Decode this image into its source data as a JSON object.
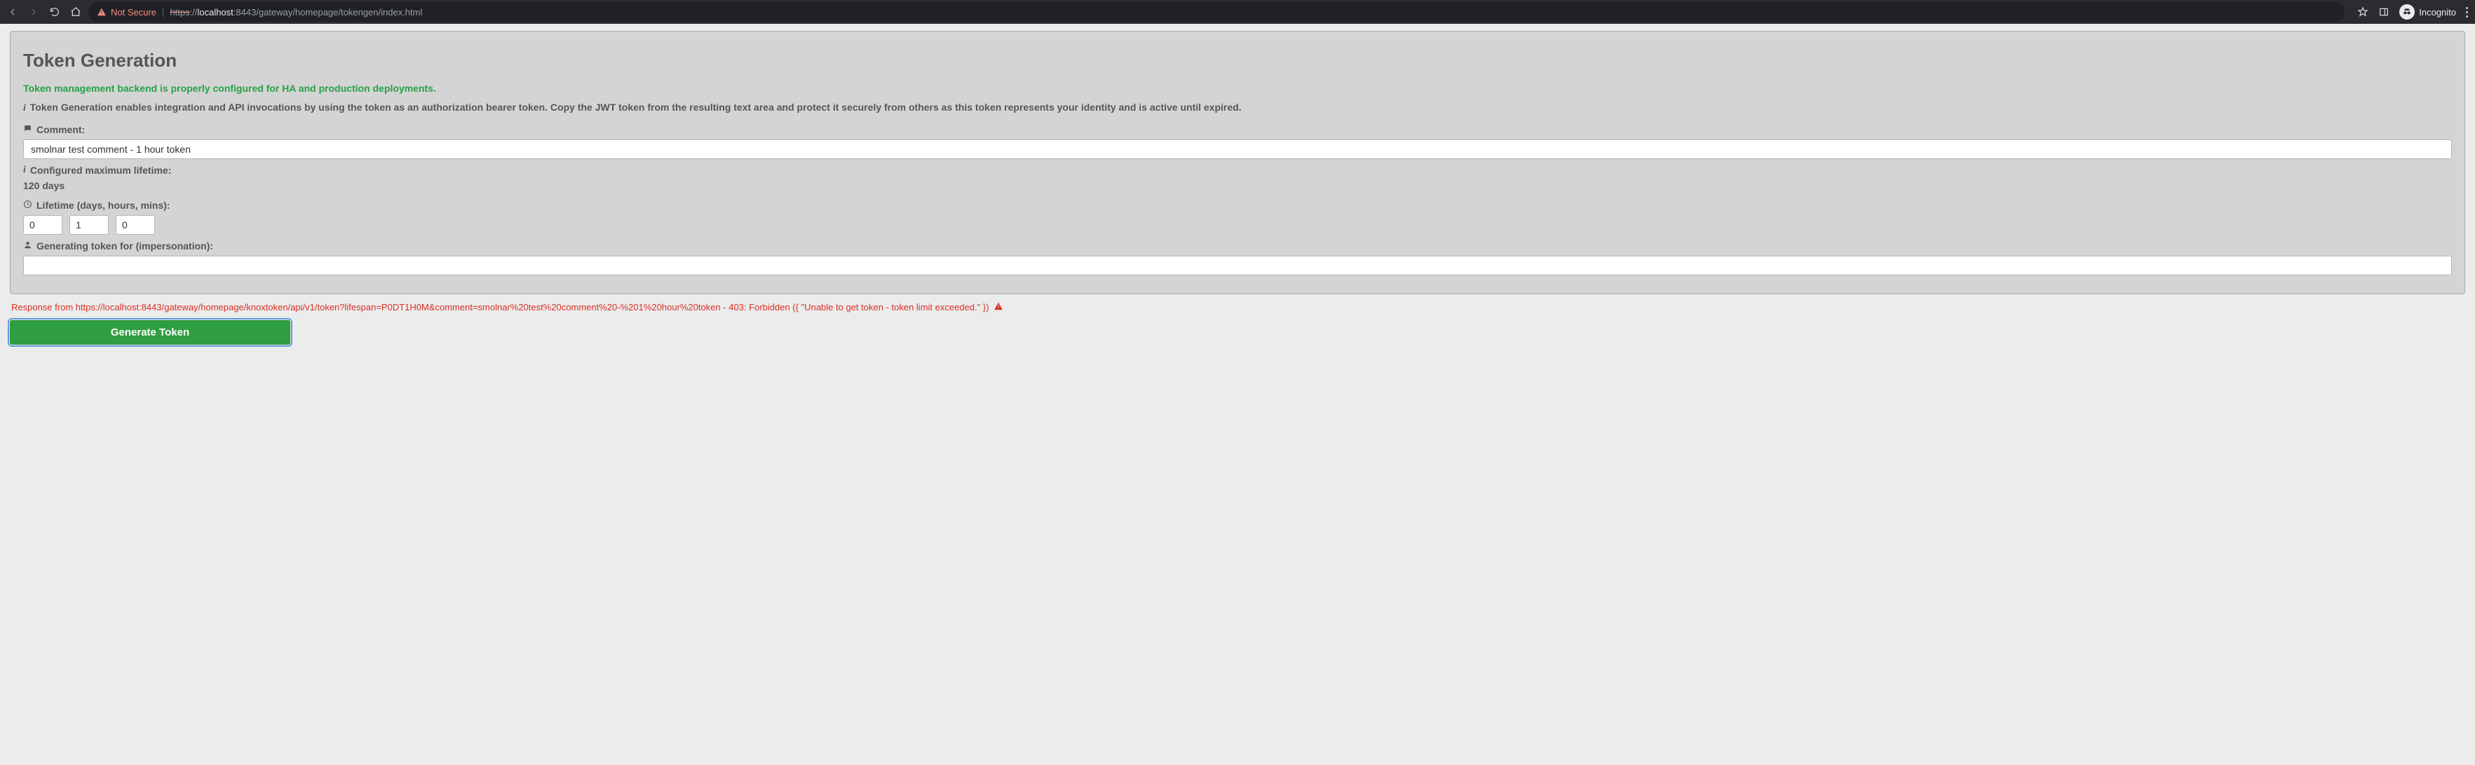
{
  "chrome": {
    "not_secure_label": "Not Secure",
    "url_scheme": "https",
    "url_schemesep": "://",
    "url_host": "localhost",
    "url_rest": ":8443/gateway/homepage/tokengen/index.html",
    "incognito_label": "Incognito"
  },
  "page": {
    "title": "Token Generation",
    "status_ok": "Token management backend is properly configured for HA and production deployments.",
    "description": "Token Generation enables integration and API invocations by using the token as an authorization bearer token. Copy the JWT token from the resulting text area and protect it securely from others as this token represents your identity and is active until expired.",
    "comment": {
      "label": "Comment:",
      "value": "smolnar test comment - 1 hour token"
    },
    "max_lifetime": {
      "label": "Configured maximum lifetime:",
      "value": "120 days"
    },
    "lifetime": {
      "label": "Lifetime (days, hours, mins):",
      "days": "0",
      "hours": "1",
      "mins": "0"
    },
    "impersonation": {
      "label": "Generating token for (impersonation):",
      "value": ""
    },
    "error": "Response from https://localhost:8443/gateway/homepage/knoxtoken/api/v1/token?lifespan=P0DT1H0M&comment=smolnar%20test%20comment%20-%201%20hour%20token - 403: Forbidden ({ \"Unable to get token - token limit exceeded.\" })",
    "generate_button": "Generate Token"
  }
}
